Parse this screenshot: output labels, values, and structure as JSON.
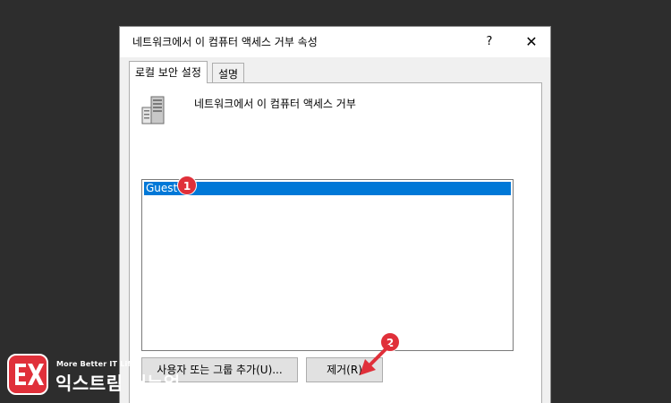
{
  "dialog": {
    "title": "네트워크에서 이 컴퓨터 액세스 거부 속성",
    "help_label": "?",
    "close_glyph": "✕"
  },
  "tabs": [
    {
      "label": "로컬 보안 설정",
      "active": true
    },
    {
      "label": "설명",
      "active": false
    }
  ],
  "panel": {
    "policy_name": "네트워크에서 이 컴퓨터 액세스 거부",
    "list_items": [
      {
        "label": "Guest",
        "selected": true
      }
    ],
    "add_button_label": "사용자 또는 그룹 추가(U)...",
    "remove_button_label": "제거(R)"
  },
  "annotations": {
    "badge_1": "1",
    "badge_2": "2"
  },
  "logo": {
    "tagline": "More Better IT Life",
    "name": "익스트림 매뉴얼"
  },
  "colors": {
    "selection": "#0078d7",
    "badge": "#e0303a",
    "logo_red": "#e0303a"
  },
  "icons": {
    "server": "server-icon",
    "close": "close-icon",
    "arrow": "arrow-icon"
  }
}
